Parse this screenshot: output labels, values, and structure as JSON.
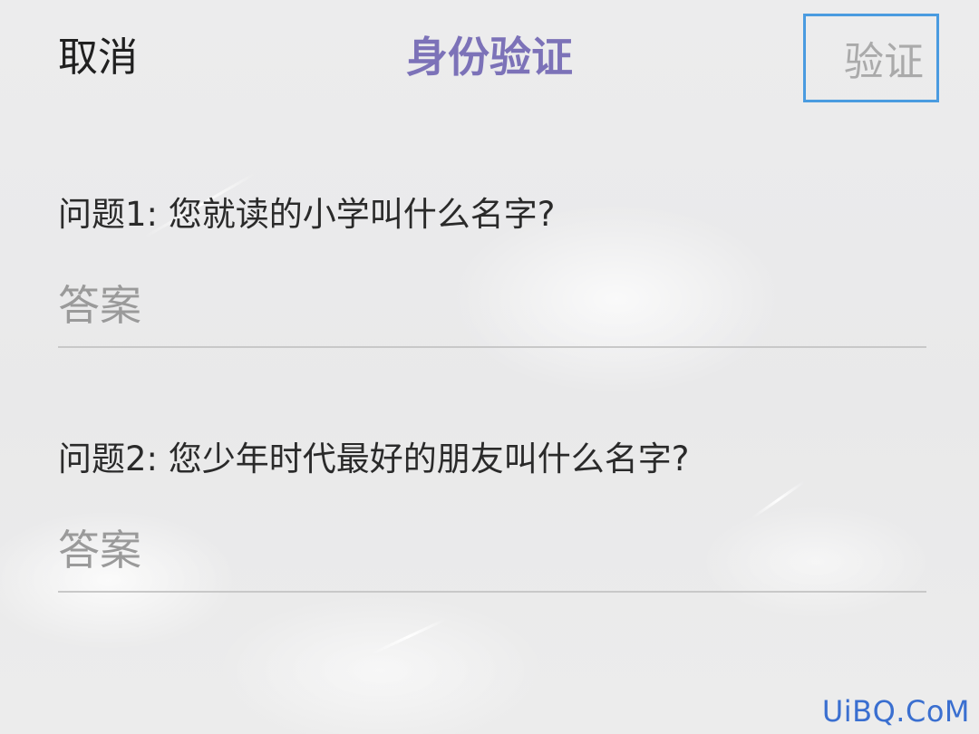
{
  "header": {
    "cancel_label": "取消",
    "title": "身份验证",
    "verify_label": "验证"
  },
  "questions": [
    {
      "label": "问题1: 您就读的小学叫什么名字?",
      "answer_value": "",
      "answer_placeholder": "答案"
    },
    {
      "label": "问题2: 您少年时代最好的朋友叫什么名字?",
      "answer_value": "",
      "answer_placeholder": "答案"
    }
  ],
  "watermark": "UiBQ.CoM",
  "colors": {
    "title": "#7c72b8",
    "verify_border": "#4a9be0",
    "verify_text": "#aaaaaa",
    "watermark": "#3a6fd0"
  }
}
